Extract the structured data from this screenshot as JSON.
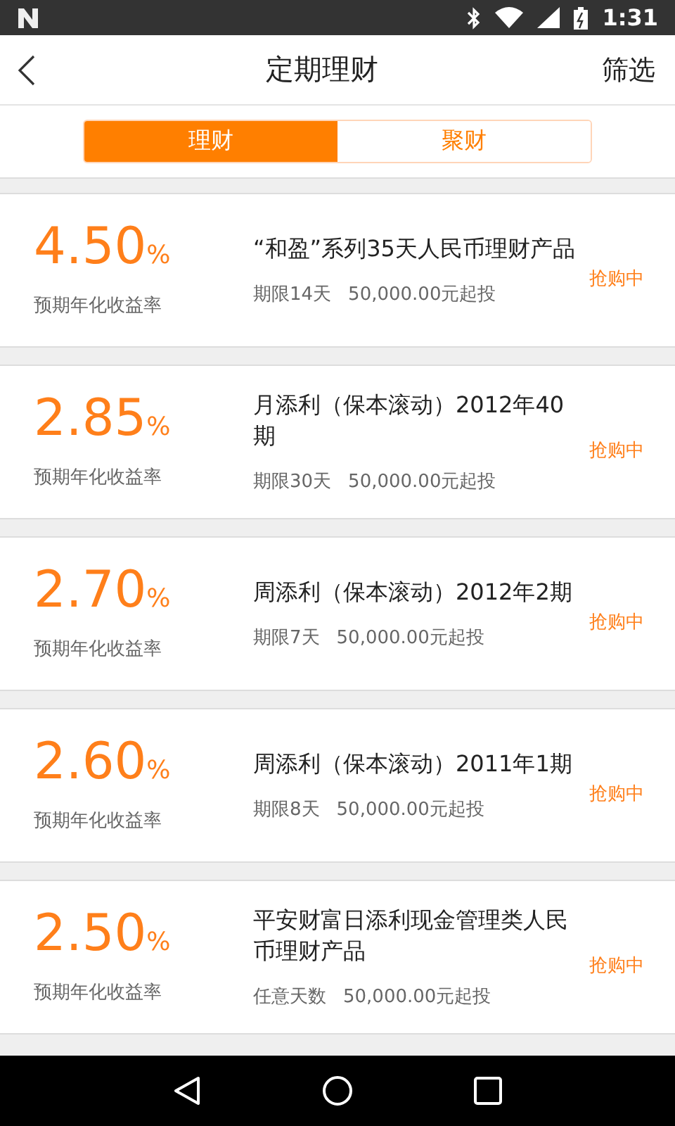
{
  "status_bar": {
    "time": "1:31"
  },
  "header": {
    "title": "定期理财",
    "action": "筛选"
  },
  "tabs": [
    {
      "label": "理财",
      "selected": true
    },
    {
      "label": "聚财",
      "selected": false
    }
  ],
  "products": [
    {
      "rate": "4.50",
      "unit": "%",
      "rate_label": "预期年化收益率",
      "name": "“和盈”系列35天人民币理财产品",
      "term": "期限14天",
      "min_invest": "50,000.00元起投",
      "status": "抢购中"
    },
    {
      "rate": "2.85",
      "unit": "%",
      "rate_label": "预期年化收益率",
      "name": "月添利（保本滚动）2012年40期",
      "term": "期限30天",
      "min_invest": "50,000.00元起投",
      "status": "抢购中"
    },
    {
      "rate": "2.70",
      "unit": "%",
      "rate_label": "预期年化收益率",
      "name": "周添利（保本滚动）2012年2期",
      "term": "期限7天",
      "min_invest": "50,000.00元起投",
      "status": "抢购中"
    },
    {
      "rate": "2.60",
      "unit": "%",
      "rate_label": "预期年化收益率",
      "name": "周添利（保本滚动）2011年1期",
      "term": "期限8天",
      "min_invest": "50,000.00元起投",
      "status": "抢购中"
    },
    {
      "rate": "2.50",
      "unit": "%",
      "rate_label": "预期年化收益率",
      "name": "平安财富日添利现金管理类人民币理财产品",
      "term": "任意天数",
      "min_invest": "50,000.00元起投",
      "status": "抢购中"
    }
  ]
}
